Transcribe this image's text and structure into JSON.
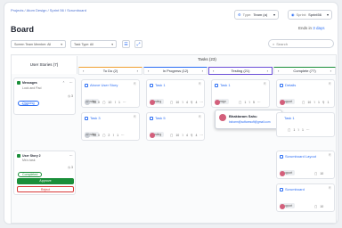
{
  "breadcrumb": "Projects / Atom Design / Sprint 56 / Scrumboard",
  "page_title": "Board",
  "type_filter": {
    "label": "Type:",
    "value": "Team (a)"
  },
  "sprint_filter": {
    "label": "Sprint:",
    "value": "Sprint56"
  },
  "ends": {
    "prefix": "Ends in",
    "value": "3 days"
  },
  "filters": {
    "team_member": "Screen Team Member: All",
    "task_type": "Task Type: All"
  },
  "search_placeholder": "Search",
  "tasks_header": "Tasks (23)",
  "user_stories_header": "User Stories (7)",
  "columns": [
    "To Do (2)",
    "In Progress (12)",
    "Testing (21)",
    "Complete (77)"
  ],
  "story1": {
    "title": "Messages",
    "sub": "Lock and Pad",
    "status": "Ongoing",
    "count": "3",
    "add": "+ Task"
  },
  "story2": {
    "title": "User Story 2",
    "sub": "Ms's task",
    "status": "Completed",
    "count": "3",
    "approve": "Approve",
    "reject": "Reject"
  },
  "todo_cards": [
    {
      "title": "Above User Story",
      "tag": "Testing",
      "c1": "0",
      "c2": "10",
      "c3": "1",
      "avatar": "AV"
    },
    {
      "title": "Task 3",
      "tag": "Testing",
      "c1": "0",
      "c2": "2",
      "c3": "1",
      "avatar": "AV"
    }
  ],
  "inprogress_cards": [
    {
      "title": "Task 1",
      "tag": "Testing",
      "c1": "10",
      "c2": "4",
      "c3": "4"
    },
    {
      "title": "Task 5",
      "tag": "Testing",
      "c1": "10",
      "c2": "4",
      "c3": "4"
    }
  ],
  "testing_card": {
    "title": "Task 1",
    "tag": "Design",
    "c1": "1",
    "c2": "5"
  },
  "tooltip": {
    "name": "Bhaktaram Sahu",
    "email": "bsharm@softaresoft@gmail.com"
  },
  "complete_cards": [
    {
      "title": "Details",
      "tag": "Support",
      "c1": "10",
      "c2": "1",
      "c3": "1"
    },
    {
      "title": "Task 1",
      "tag": "Support",
      "c1": "1",
      "c2": "1"
    },
    {
      "title": "Scrumboard Layout",
      "tag": "Support",
      "c1": "10"
    },
    {
      "title": "Scrumboard",
      "tag": "Support",
      "c1": "10"
    }
  ],
  "colors": {
    "accent": "#2a6df4",
    "complete": "#1b8f3a",
    "reject": "#d93a3a",
    "testing_border": "#6b4fd8"
  }
}
